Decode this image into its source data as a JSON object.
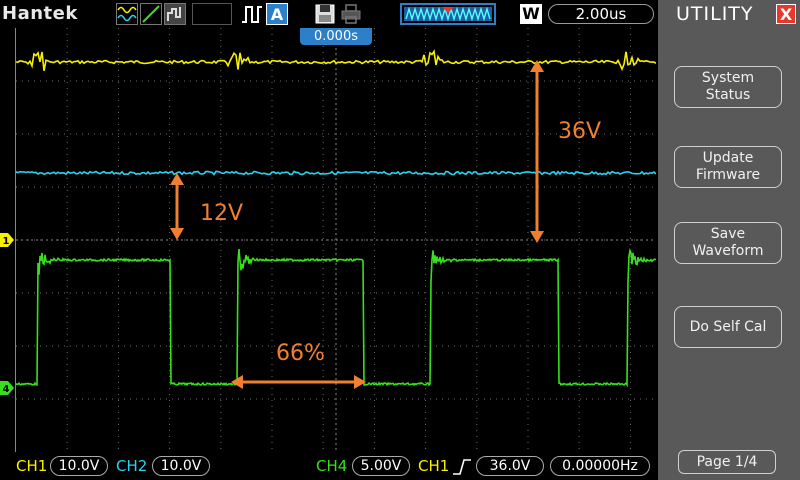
{
  "topbar": {
    "brand": "Hantek",
    "mode_letter": "W",
    "timebase": "2.00us",
    "trigger_offset": "0.000s"
  },
  "annotations": {
    "ch1_ch2_gap": "12V",
    "ch1_amplitude": "36V",
    "duty_cycle": "66%"
  },
  "channels": {
    "ch1": {
      "label": "CH1",
      "scale": "10.0V",
      "color": "#f7f000"
    },
    "ch2": {
      "label": "CH2",
      "scale": "10.0V",
      "color": "#29d3f0"
    },
    "ch4": {
      "label": "CH4",
      "scale": "5.00V",
      "color": "#36e01a"
    }
  },
  "trigger": {
    "source": "CH1",
    "level": "36.0V",
    "frequency": "0.00000Hz"
  },
  "markers": {
    "ch1": "1",
    "ch4": "4"
  },
  "panel": {
    "title": "UTILITY",
    "close": "X",
    "buttons": [
      {
        "label": "System\nStatus"
      },
      {
        "label": "Update\nFirmware"
      },
      {
        "label": "Save\nWaveform"
      },
      {
        "label": "Do Self Cal"
      }
    ],
    "page": "Page 1/4"
  },
  "colors": {
    "annotation": "#f08030",
    "accent": "#2c7fc9",
    "panel_bg": "#595959"
  }
}
